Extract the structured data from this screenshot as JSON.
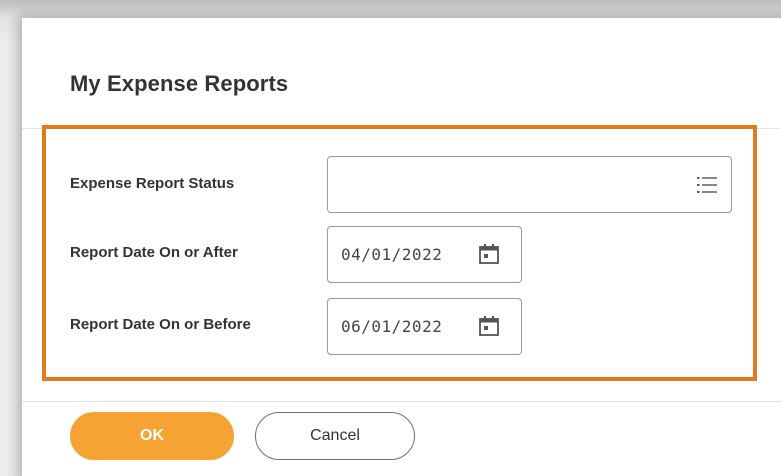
{
  "dialog": {
    "title": "My Expense Reports"
  },
  "form": {
    "status": {
      "label": "Expense Report Status",
      "value": "",
      "icon": "list-icon"
    },
    "date_after": {
      "label": "Report Date On or After",
      "value": "04/01/2022",
      "icon": "calendar-icon"
    },
    "date_before": {
      "label": "Report Date On or Before",
      "value": "06/01/2022",
      "icon": "calendar-icon"
    }
  },
  "buttons": {
    "ok_label": "OK",
    "cancel_label": "Cancel"
  },
  "colors": {
    "highlight_border": "#e07b1d",
    "ok_button": "#f7a234",
    "text": "#333333"
  }
}
